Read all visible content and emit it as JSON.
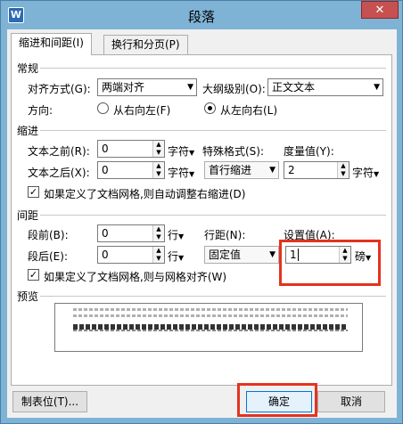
{
  "window": {
    "title": "段落",
    "app_icon": "W",
    "close": "✕"
  },
  "tabs": [
    {
      "label": "缩进和间距(I)",
      "active": true
    },
    {
      "label": "换行和分页(P)",
      "active": false
    }
  ],
  "general": {
    "heading": "常规",
    "alignment_label": "对齐方式(G):",
    "alignment_value": "两端对齐",
    "outline_label": "大纲级别(O):",
    "outline_value": "正文文本",
    "direction_label": "方向:",
    "direction_rtl": "从右向左(F)",
    "direction_ltr": "从左向右(L)"
  },
  "indent": {
    "heading": "缩进",
    "before_label": "文本之前(R):",
    "before_value": "0",
    "before_unit": "字符",
    "special_label": "特殊格式(S):",
    "special_value": "首行缩进",
    "measure_label": "度量值(Y):",
    "measure_value": "2",
    "measure_unit": "字符",
    "after_label": "文本之后(X):",
    "after_value": "0",
    "after_unit": "字符",
    "grid_check": "如果定义了文档网格,则自动调整右缩进(D)"
  },
  "spacing": {
    "heading": "间距",
    "before_label": "段前(B):",
    "before_value": "0",
    "before_unit": "行",
    "line_label": "行距(N):",
    "set_label": "设置值(A):",
    "after_label": "段后(E):",
    "after_value": "0",
    "after_unit": "行",
    "line_value": "固定值",
    "set_value": "1",
    "set_unit": "磅",
    "grid_check": "如果定义了文档网格,则与网格对齐(W)"
  },
  "preview": {
    "heading": "预览"
  },
  "footer": {
    "tabs_button": "制表位(T)...",
    "ok_button": "确定",
    "cancel_button": "取消"
  },
  "colors": {
    "highlight": "#e5321e",
    "titlebar": "#7fb3d5"
  }
}
